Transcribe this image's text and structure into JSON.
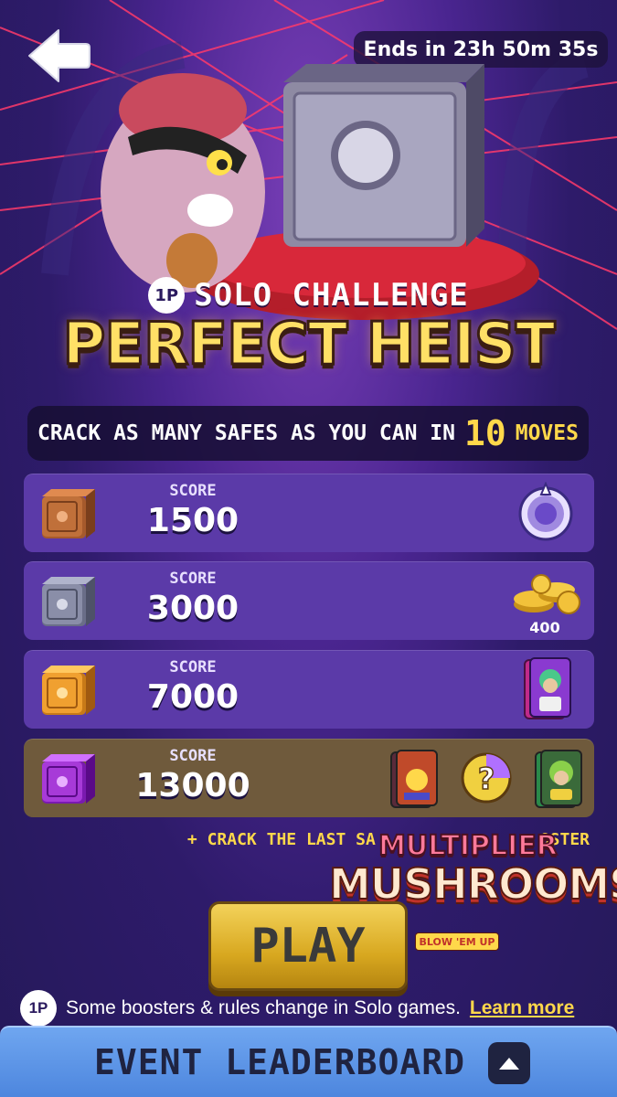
{
  "header": {
    "timer": "Ends in 23h 50m 35s"
  },
  "event": {
    "mode_tag": "1P",
    "subtitle": "SOLO CHALLENGE",
    "title": "PERFECT HEIST"
  },
  "instruction": {
    "prefix": "CRACK AS MANY SAFES AS YOU CAN IN",
    "moves_count": "10",
    "suffix": "MOVES"
  },
  "tiers": [
    {
      "label": "SCORE",
      "score": "1500",
      "safe_color": "#c0703a",
      "reward": "spin-wheel-icon"
    },
    {
      "label": "SCORE",
      "score": "3000",
      "safe_color": "#8a8ea8",
      "reward": "coins-icon",
      "reward_text": "400"
    },
    {
      "label": "SCORE",
      "score": "7000",
      "safe_color": "#f0a030",
      "reward": "character-card-icon"
    },
    {
      "label": "SCORE",
      "score": "13000",
      "safe_color": "#a73ad8",
      "reward": "card-bundle-icon"
    }
  ],
  "crack_note": "+ CRACK THE LAST SA",
  "crack_note_end": "OSTER",
  "booster": {
    "line1": "MULTIPLIER",
    "line2": "MUSHROOMS",
    "line3": "BLOW 'EM UP"
  },
  "play_label": "PLAY",
  "rules": {
    "mode_tag": "1P",
    "text": "Some boosters & rules change in Solo games.",
    "link": "Learn more"
  },
  "leaderboard_label": "EVENT LEADERBOARD",
  "colors": {
    "title_yellow": "#ffe066",
    "accent_yellow": "#ffd84a",
    "tier_purple": "#5b3aa8",
    "tier_gold": "#6f5a3c",
    "leaderboard_blue": "#5b93e6"
  }
}
